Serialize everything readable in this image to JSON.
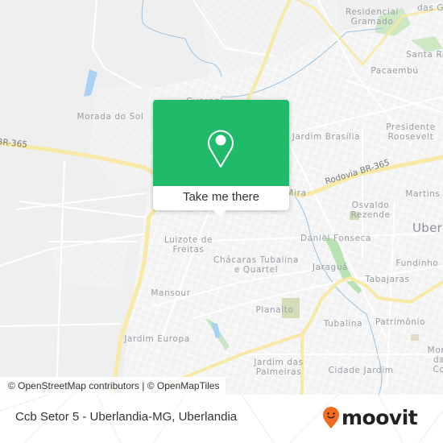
{
  "map": {
    "place_labels": [
      {
        "text": "Residencial\nGramado",
        "name": "label-residencial-gramado"
      },
      {
        "text": "das Gr",
        "name": "label-das-gr"
      },
      {
        "text": "Santa Ro",
        "name": "label-santa-ro"
      },
      {
        "text": "Pacaembú",
        "name": "label-pacaembu"
      },
      {
        "text": "Morada do Sol",
        "name": "label-morada-do-sol"
      },
      {
        "text": "Guarani",
        "name": "label-guarani"
      },
      {
        "text": "Jardim Brasília",
        "name": "label-jardim-brasilia"
      },
      {
        "text": "Presidente\nRoosevelt",
        "name": "label-presidente-roosevelt"
      },
      {
        "text": "Martins",
        "name": "label-martins"
      },
      {
        "text": "Osvaldo\nRezende",
        "name": "label-osvaldo-rezende"
      },
      {
        "text": "Daniel Fonseca",
        "name": "label-daniel-fonseca"
      },
      {
        "text": "Luizote de\nFreitas",
        "name": "label-luizote-de-freitas"
      },
      {
        "text": "Chácaras Tubalina\ne Quartel",
        "name": "label-chacaras-tubalina"
      },
      {
        "text": "Jaraguá",
        "name": "label-jaragua"
      },
      {
        "text": "Fundinho",
        "name": "label-fundinho"
      },
      {
        "text": "Tabajaras",
        "name": "label-tabajaras"
      },
      {
        "text": "Mansour",
        "name": "label-mansour"
      },
      {
        "text": "Planalto",
        "name": "label-planalto"
      },
      {
        "text": "Tubalina",
        "name": "label-tubalina"
      },
      {
        "text": "Patrimônio",
        "name": "label-patrimonio"
      },
      {
        "text": "Jardim Europa",
        "name": "label-jardim-europa"
      },
      {
        "text": "Jardim das\nPalmeiras",
        "name": "label-jardim-das-palmeiras"
      },
      {
        "text": "Cidade Jardim",
        "name": "label-cidade-jardim"
      },
      {
        "text": "Mora\nda Co",
        "name": "label-morada-colina"
      },
      {
        "text": "Mira",
        "name": "label-mira"
      }
    ],
    "city_label": "Uber",
    "road_labels": {
      "br365_west": "BR-365",
      "br365_east": "Rodovia BR-365"
    },
    "attribution": "© OpenStreetMap contributors | © OpenMapTiles"
  },
  "popup": {
    "icon": "map-pin-icon",
    "button_label": "Take me there",
    "accent_color": "#1fba6a"
  },
  "footer": {
    "location_title": "Ccb Setor 5 - Uberlandia-MG, Uberlandia",
    "brand": "moovit",
    "brand_color": "#f26b21"
  }
}
